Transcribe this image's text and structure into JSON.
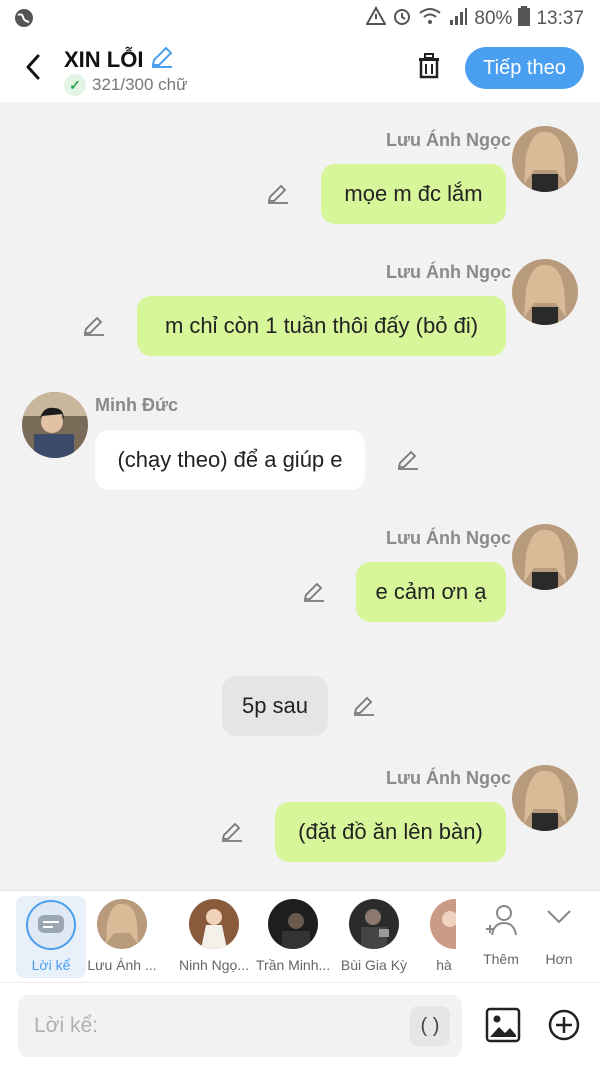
{
  "status": {
    "battery": "80%",
    "time": "13:37"
  },
  "header": {
    "title": "XIN LỖI",
    "counter": "321/300 chữ",
    "next_label": "Tiếp theo"
  },
  "messages": [
    {
      "sender": "Lưu Ánh Ngọc",
      "text": "mọe m đc lắm"
    },
    {
      "sender": "Lưu Ánh Ngọc",
      "text": "m chỉ còn 1 tuần thôi đấy (bỏ đi)"
    },
    {
      "sender": "Minh Đức",
      "text": "(chạy theo) để a giúp e"
    },
    {
      "sender": "Lưu Ánh Ngọc",
      "text": "e cảm ơn ạ"
    },
    {
      "sender": "",
      "text": "5p sau"
    },
    {
      "sender": "Lưu Ánh Ngọc",
      "text": "(đặt đồ ăn lên bàn)"
    }
  ],
  "characters": [
    {
      "label": "Lời kể"
    },
    {
      "label": "Lưu Ánh ..."
    },
    {
      "label": "Ninh Ngọ..."
    },
    {
      "label": "Trần Minh..."
    },
    {
      "label": "Bùi Gia Kỳ"
    },
    {
      "label": "hà"
    }
  ],
  "actions": {
    "add_label": "Thêm",
    "more_label": "Hơn"
  },
  "input": {
    "placeholder": "Lời kể:",
    "paren": "( )"
  },
  "colors": {
    "accent": "#4b9ff0",
    "my_bubble": "#d7f69a",
    "other_bubble": "#ffffff",
    "narration_bubble": "#e5e5e5"
  }
}
